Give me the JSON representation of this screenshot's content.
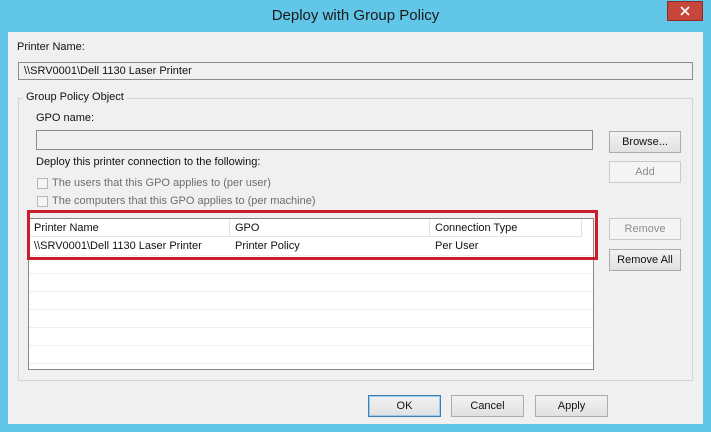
{
  "window": {
    "title": "Deploy with Group Policy"
  },
  "printer": {
    "label": "Printer Name:",
    "value": "\\\\SRV0001\\Dell 1130 Laser Printer"
  },
  "gpo_group": {
    "legend": "Group Policy Object",
    "gpo_name_label": "GPO name:",
    "gpo_name_value": "",
    "browse_label": "Browse...",
    "deploy_label": "Deploy this printer connection to the following:",
    "add_label": "Add",
    "checkbox_users": "The users that this GPO applies to (per user)",
    "checkbox_computers": "The computers that this GPO applies to (per machine)",
    "remove_label": "Remove",
    "remove_all_label": "Remove All"
  },
  "list": {
    "columns": [
      "Printer Name",
      "GPO",
      "Connection Type"
    ],
    "rows": [
      [
        "\\\\SRV0001\\Dell 1130 Laser Printer",
        "Printer Policy",
        "Per User"
      ]
    ]
  },
  "footer": {
    "ok_label": "OK",
    "cancel_label": "Cancel",
    "apply_label": "Apply"
  },
  "colors": {
    "title_bar": "#62c6e8",
    "close_button": "#c7463c",
    "highlight_border": "#c8202a"
  }
}
